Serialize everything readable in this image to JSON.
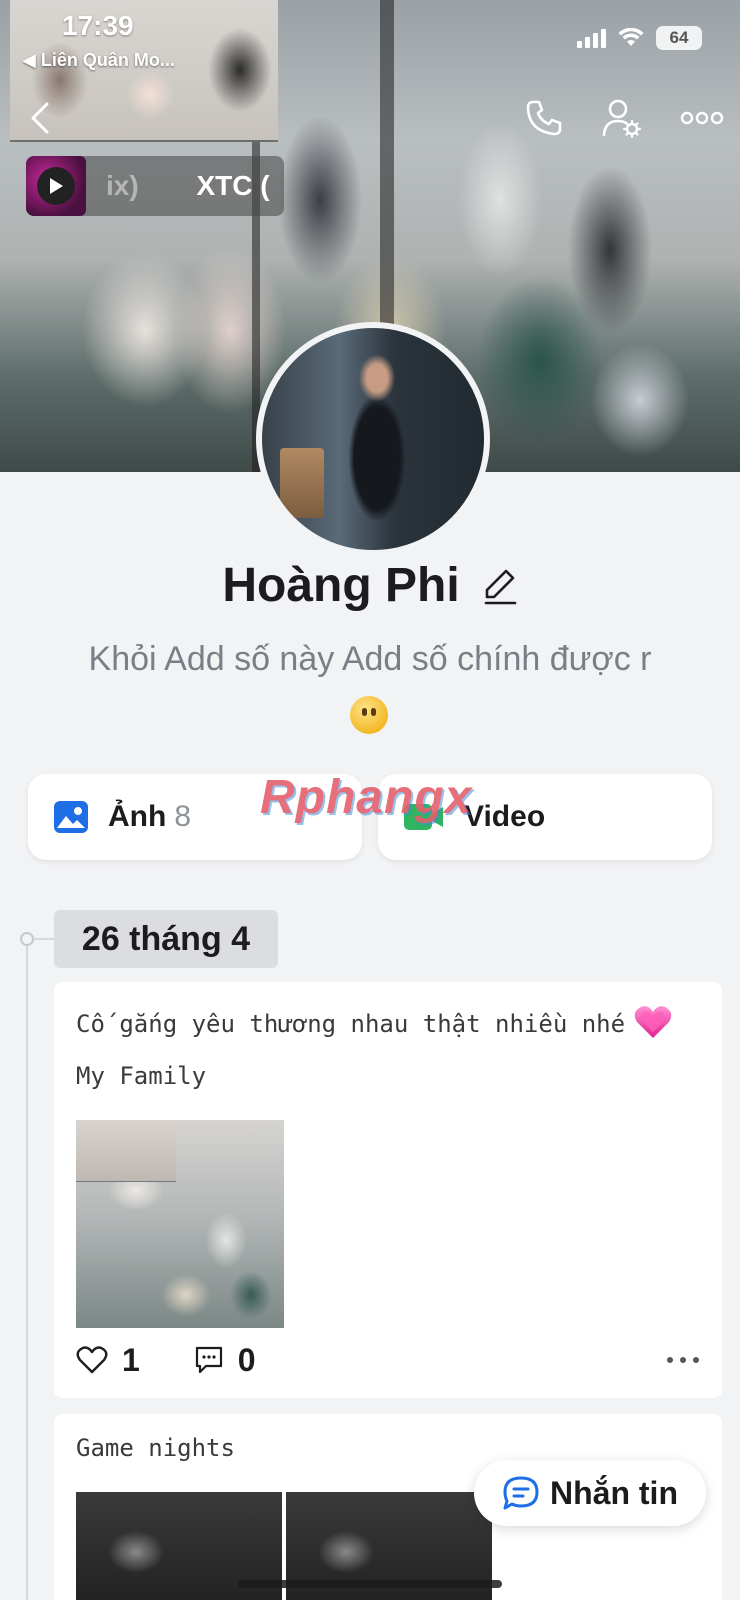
{
  "status_bar": {
    "time": "17:39",
    "back_app": "◀ Liên Quân Mo...",
    "battery": "64"
  },
  "header": {
    "music": {
      "title_faded": "ix)",
      "title": "XTC ("
    },
    "icons": [
      "back-icon",
      "phone-icon",
      "profile-settings-icon",
      "more-icon"
    ]
  },
  "profile": {
    "name": "Hoàng Phi",
    "bio": "Khỏi Add số này Add số chính được r"
  },
  "media": {
    "photos_label": "Ảnh",
    "photos_count": "8",
    "video_label": "Video"
  },
  "watermark": "Rphangx",
  "timeline": {
    "date": "26 tháng 4",
    "posts": [
      {
        "text": "Cố gắng yêu thương nhau thật nhiều nhé",
        "text2": "My Family",
        "likes": "1",
        "comments": "0"
      },
      {
        "text": "Game nights"
      }
    ]
  },
  "message_button": "Nhắn tin",
  "colors": {
    "accent_blue": "#1e6fe6",
    "video_green": "#2fb561",
    "background": "#f2f3f5"
  }
}
